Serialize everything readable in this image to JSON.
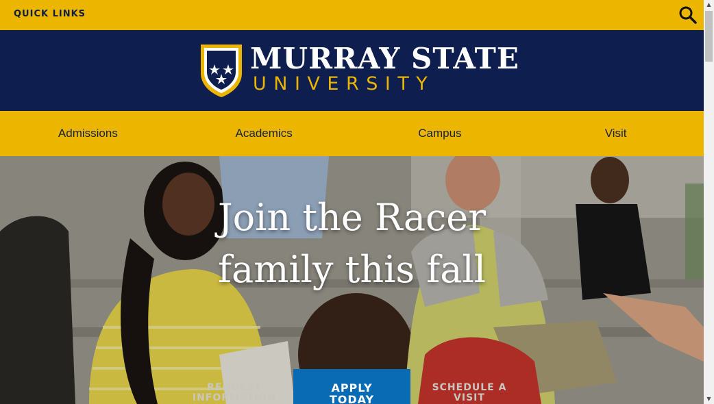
{
  "topbar": {
    "quick_links": "QUICK LINKS",
    "search_icon": "search-icon"
  },
  "brand": {
    "name_line1": "MURRAY STATE",
    "name_line2": "UNIVERSITY",
    "logo_icon": "shield-stars-icon"
  },
  "nav": {
    "items": [
      {
        "label": "Admissions"
      },
      {
        "label": "Academics"
      },
      {
        "label": "Campus"
      },
      {
        "label": "Visit"
      }
    ]
  },
  "hero": {
    "title_line1": "Join the Racer",
    "title_line2": "family this fall",
    "cta": {
      "request_line1": "REQUEST",
      "request_line2": "INFORMATION",
      "apply_line1": "APPLY",
      "apply_line2": "TODAY",
      "visit_line1": "SCHEDULE A",
      "visit_line2": "VISIT"
    }
  },
  "colors": {
    "gold": "#ecb500",
    "navy": "#0e1e4f",
    "apply_blue": "#0a6bb5"
  },
  "scrollbar": {
    "up_icon": "chevron-up-icon",
    "down_icon": "chevron-down-icon"
  }
}
